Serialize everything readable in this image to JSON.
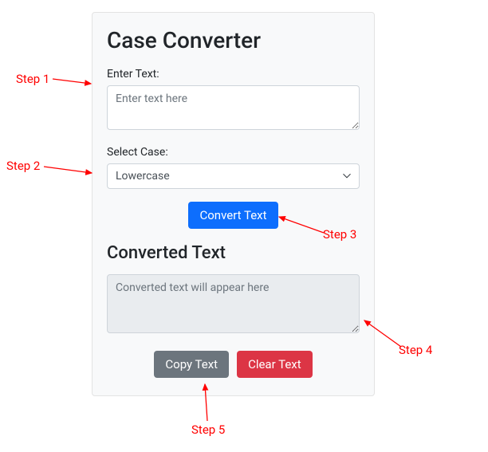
{
  "card": {
    "title": "Case Converter",
    "inputLabel": "Enter Text:",
    "inputPlaceholder": "Enter text here",
    "selectLabel": "Select Case:",
    "selectValue": "Lowercase",
    "convertBtn": "Convert Text",
    "outputTitle": "Converted Text",
    "outputPlaceholder": "Converted text will appear here",
    "copyBtn": "Copy Text",
    "clearBtn": "Clear Text"
  },
  "annotations": {
    "step1": "Step 1",
    "step2": "Step 2",
    "step3": "Step 3",
    "step4": "Step 4",
    "step5": "Step 5"
  },
  "colors": {
    "annotation": "#ff0000",
    "primary": "#0d6efd",
    "secondary": "#6c757d",
    "danger": "#dc3545"
  }
}
